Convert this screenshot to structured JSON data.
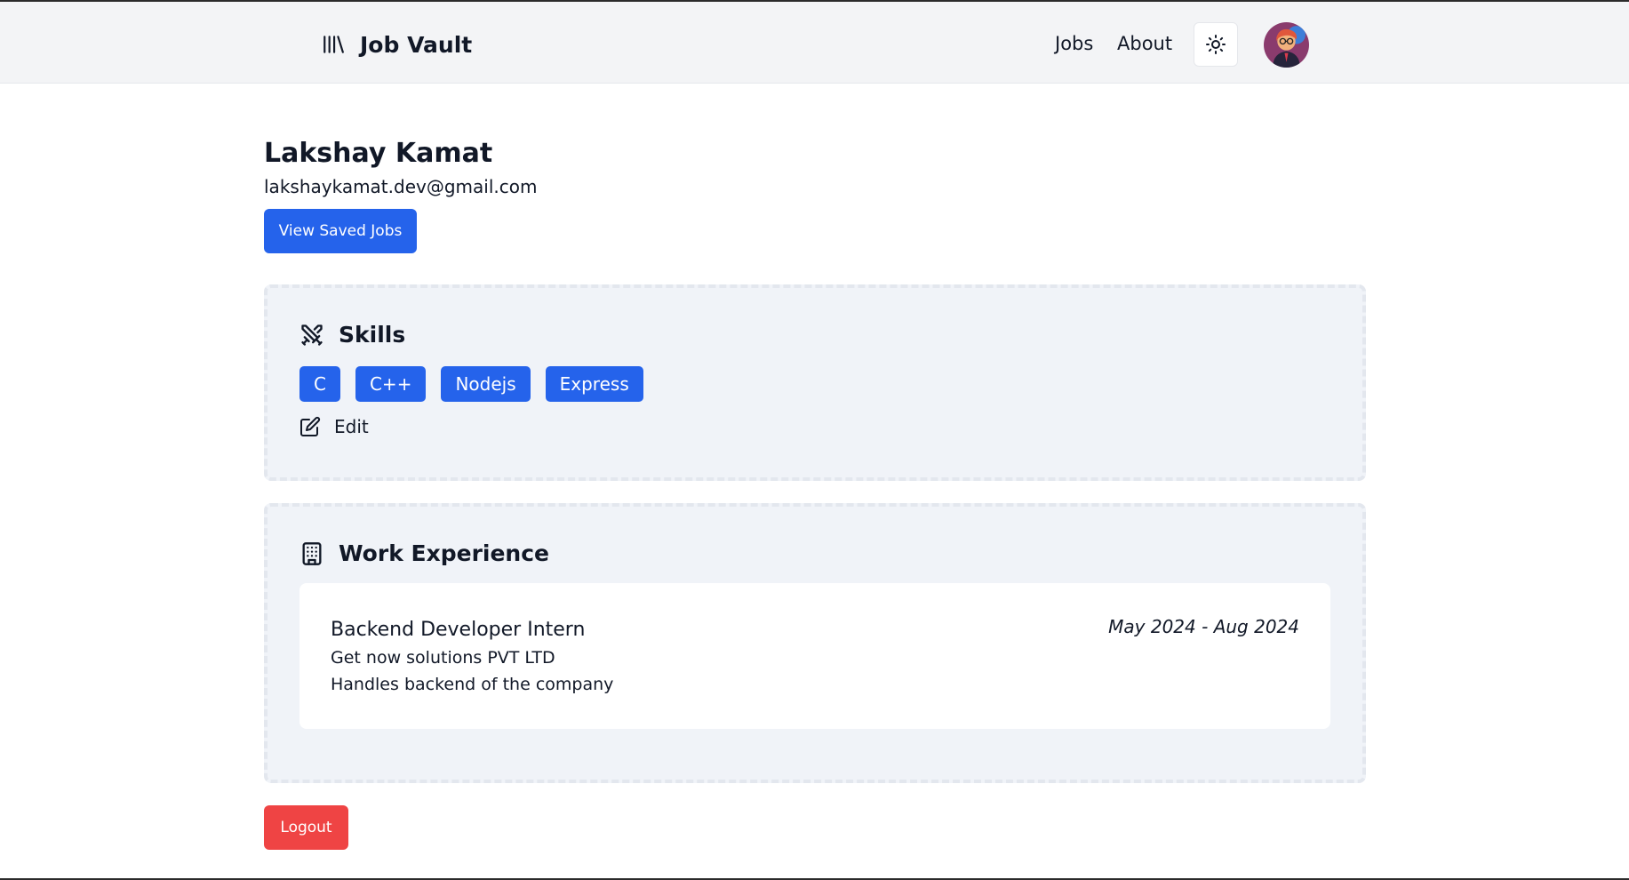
{
  "navbar": {
    "brand": "Job Vault",
    "brand_icon": "library-icon",
    "links": [
      "Jobs",
      "About"
    ],
    "theme_toggle_icon": "sun-icon",
    "avatar_icon": "user-avatar"
  },
  "profile": {
    "name": "Lakshay Kamat",
    "email": "lakshaykamat.dev@gmail.com",
    "saved_jobs_label": "View Saved Jobs"
  },
  "skills": {
    "title": "Skills",
    "icon": "crossed-swords-icon",
    "items": [
      "C",
      "C++",
      "Nodejs",
      "Express"
    ],
    "edit_label": "Edit",
    "edit_icon": "edit-icon"
  },
  "work_experience": {
    "title": "Work Experience",
    "icon": "building-icon",
    "items": [
      {
        "role": "Backend Developer Intern",
        "company": "Get now solutions PVT LTD",
        "description": "Handles backend of the company",
        "dates": "May 2024 - Aug 2024"
      }
    ]
  },
  "logout_label": "Logout",
  "colors": {
    "primary": "#2563eb",
    "danger": "#ef4444",
    "card_bg": "#f0f3f8",
    "navbar_bg": "#f3f4f6"
  }
}
